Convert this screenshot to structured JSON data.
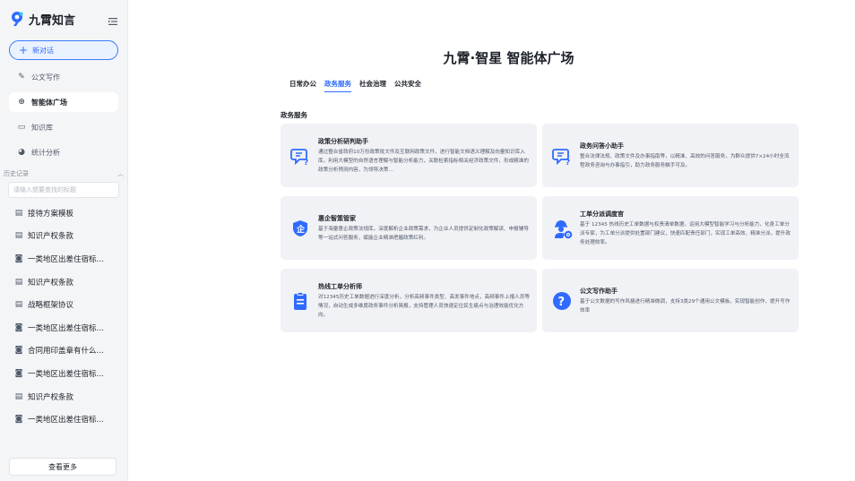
{
  "brand": {
    "name": "九霄知言"
  },
  "sidebar": {
    "new_chat": "新对话",
    "nav": [
      {
        "label": "公文写作",
        "icon": "pen-icon"
      },
      {
        "label": "智能体广场",
        "icon": "agent-icon"
      },
      {
        "label": "知识库",
        "icon": "book-icon"
      },
      {
        "label": "统计分析",
        "icon": "chart-pie-icon"
      }
    ],
    "history_title": "历史记录",
    "history_placeholder": "请输入想要查找的标题",
    "history": [
      {
        "label": "接待方案模板",
        "icon": "document-icon"
      },
      {
        "label": "知识产权条款",
        "icon": "document-icon"
      },
      {
        "label": "一类地区出差住宿标…",
        "icon": "chat-icon"
      },
      {
        "label": "知识产权条款",
        "icon": "document-icon"
      },
      {
        "label": "战略框架协议",
        "icon": "document-icon"
      },
      {
        "label": "一类地区出差住宿标…",
        "icon": "chat-icon"
      },
      {
        "label": "合同用印盖章有什么…",
        "icon": "chat-icon"
      },
      {
        "label": "一类地区出差住宿标…",
        "icon": "chat-icon"
      },
      {
        "label": "知识产权条款",
        "icon": "document-icon"
      },
      {
        "label": "一类地区出差住宿标…",
        "icon": "chat-icon"
      }
    ],
    "view_more": "查看更多"
  },
  "main": {
    "title": "九霄·智星 智能体广场",
    "tabs": [
      "日常办公",
      "政务服务",
      "社会治理",
      "公共安全"
    ],
    "active_tab": "政务服务",
    "section": "政务服务",
    "cards": [
      {
        "title": "政策分析研判助手",
        "icon": "chat-question-icon",
        "desc": "通过整合省政府10万份政策批文件及互联网政策文件，进行智能文档语义理解及向量知识库入库。利用大模型的自然语言理解与智能分析能力，关联检索指标相关经济政策文件，形成精准的政策分析预测内容，为领导决策…"
      },
      {
        "title": "政务问答小助手",
        "icon": "chat-question-icon",
        "desc": "整合法律法规、政策文件及办事指南等，以精准、高效的问答服务，为群众提供7×24小时全流程政务咨询与办事指引，助力政务服务触手可及。"
      },
      {
        "title": "惠企智策管家",
        "icon": "shield-icon",
        "desc": "基于海量惠企政策法规库，深度解析企业政策需求，为企业人员提供定制化政策解读、申报辅导等一站式问答服务，赋能企业精准把握政策红利。"
      },
      {
        "title": "工单分派调度官",
        "icon": "worker-gear-icon",
        "desc": "基于 12345 热线历史工单数据与权责清单数据，运用大模型智能学习与分析能力，化身工单分派专家，为工单分派提供处置部门建议，快速匹配责任部门，实现工单高效、精准分派，提升政务处理效率。"
      },
      {
        "title": "热线工单分析师",
        "icon": "clipboard-icon",
        "desc": "对12345历史工单数据进行深度分析，分析高频事件类型、高发事件地点，高频事件上报人员等情况，自动生成多维度政务事件分析简报，支持管理人员快速定位民生痛点与治理效能优化方向。"
      },
      {
        "title": "公文写作助手",
        "icon": "question-circle-icon",
        "desc": "基于公文数据的写作风格进行精准微调，支持3类29个通用公文模板，实现智能创作，提升写作效率"
      }
    ]
  },
  "colors": {
    "accent": "#2f6bff",
    "sidebar_bg": "#f4f5f7",
    "card_bg": "#f1f2f5"
  }
}
